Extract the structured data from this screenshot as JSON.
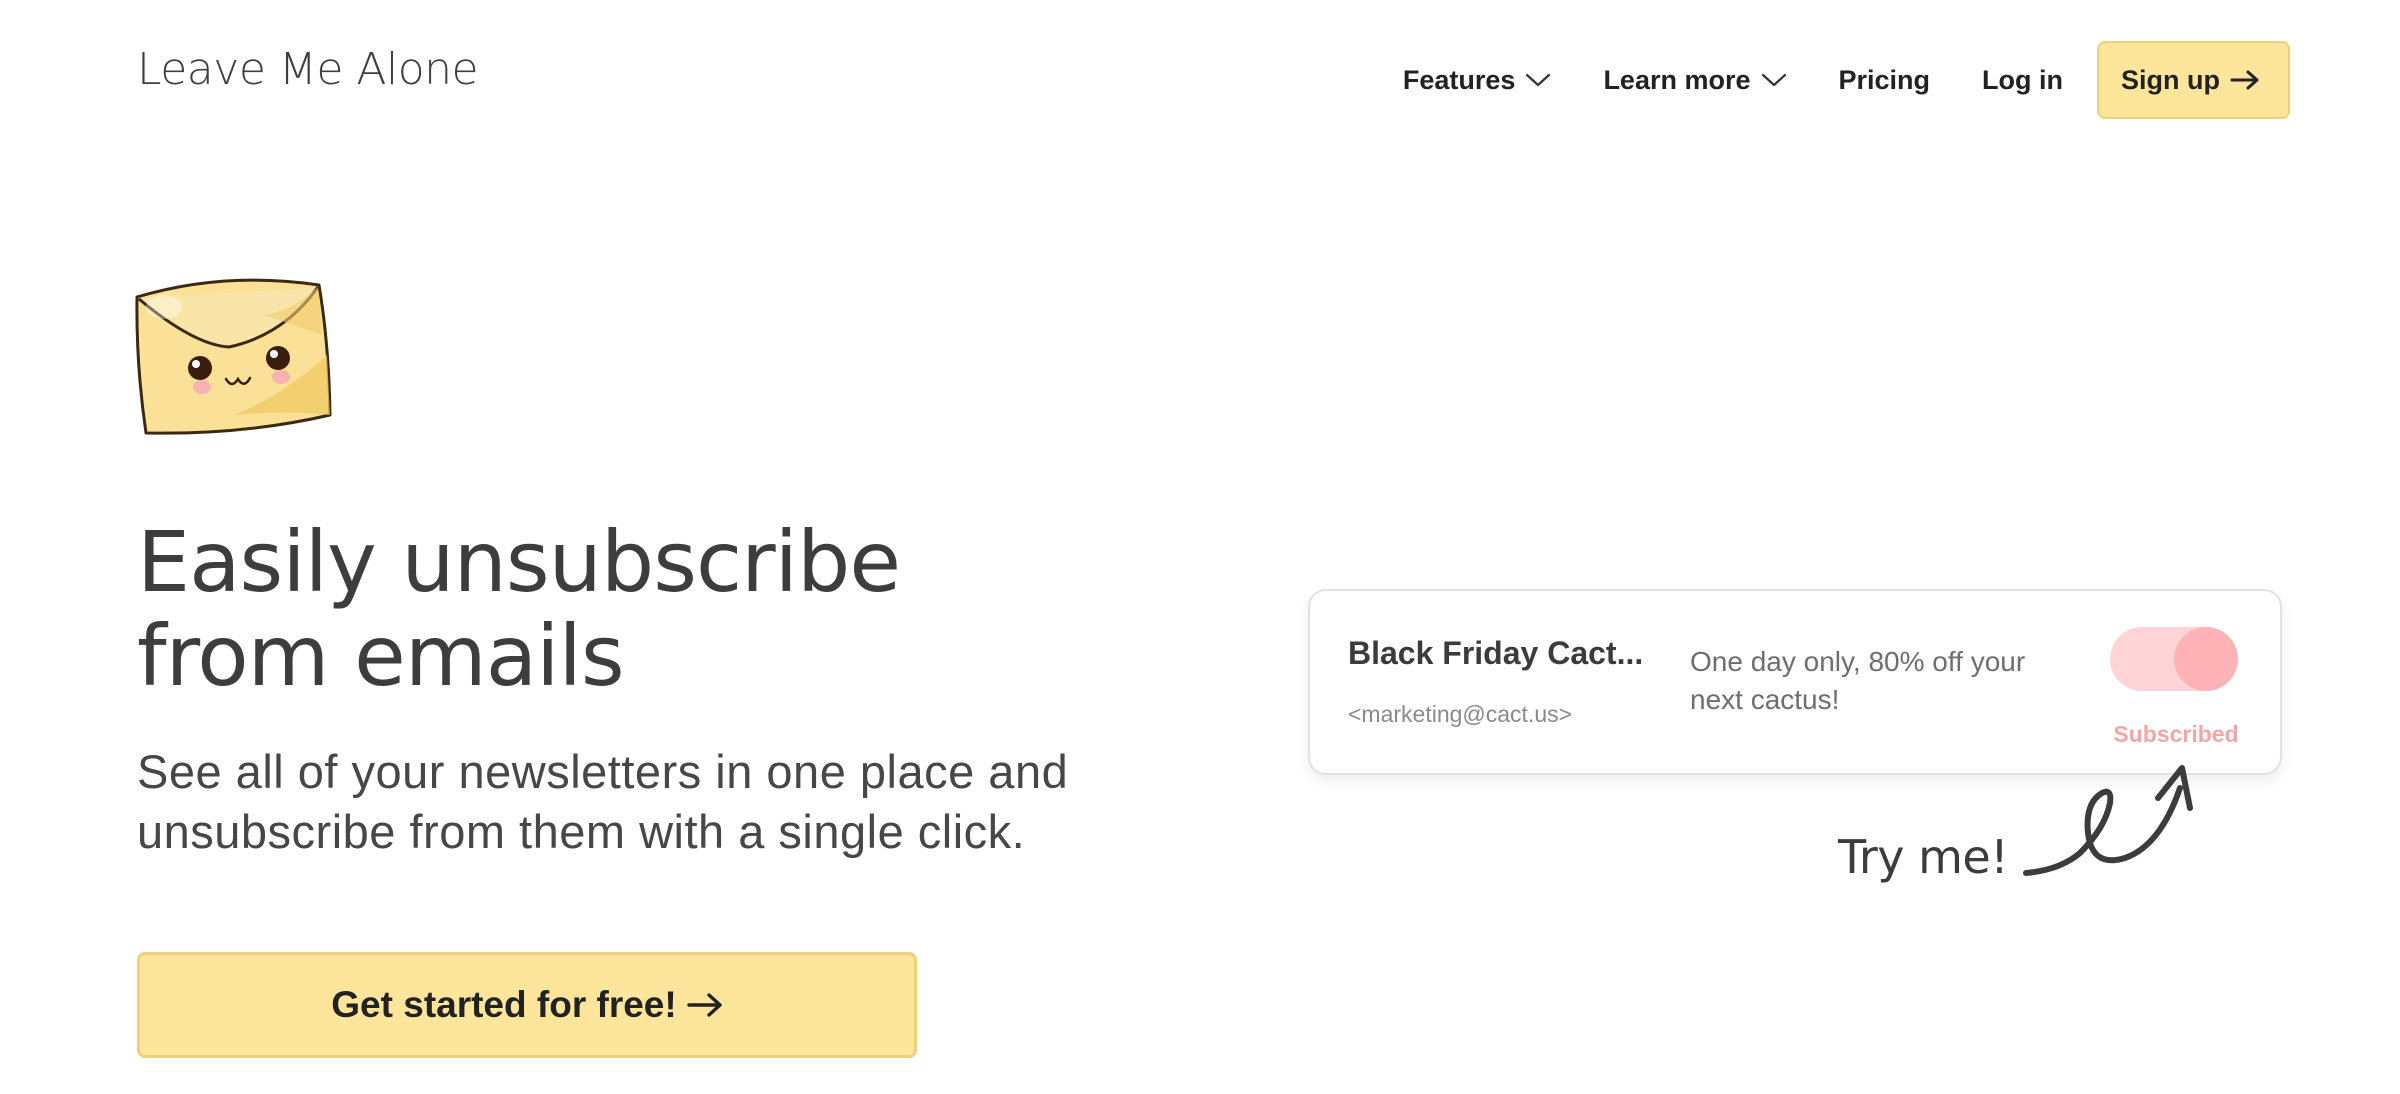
{
  "header": {
    "logo": "Leave Me Alone",
    "nav": [
      {
        "label": "Features",
        "has_dropdown": true
      },
      {
        "label": "Learn more",
        "has_dropdown": true
      },
      {
        "label": "Pricing",
        "has_dropdown": false
      },
      {
        "label": "Log in",
        "has_dropdown": false
      }
    ],
    "signup_label": "Sign up"
  },
  "hero": {
    "headline_line1": "Easily unsubscribe",
    "headline_line2": "from emails",
    "subline_line1": "See all of your newsletters in one place and",
    "subline_line2": "unsubscribe from them with a single click.",
    "cta_label": "Get started for free!"
  },
  "demo_card": {
    "title": "Black Friday Cact...",
    "sender": "<marketing@cact.us>",
    "description_line1": "One day only, 80% off your",
    "description_line2": "next cactus!",
    "toggle_on": true,
    "status_label": "Subscribed"
  },
  "try_me_label": "Try me!",
  "colors": {
    "accent": "#fde59b",
    "accent_border": "#f0d179",
    "toggle_track": "#ffd4d6",
    "toggle_knob": "#ffb3b6",
    "status_text": "#f3a6a6",
    "text_dark": "#3b3b3b"
  },
  "icons": {
    "chevron": "chevron-down-icon",
    "arrow": "arrow-right-icon",
    "mascot": "envelope-mascot-icon",
    "squiggle": "squiggle-arrow-icon"
  }
}
